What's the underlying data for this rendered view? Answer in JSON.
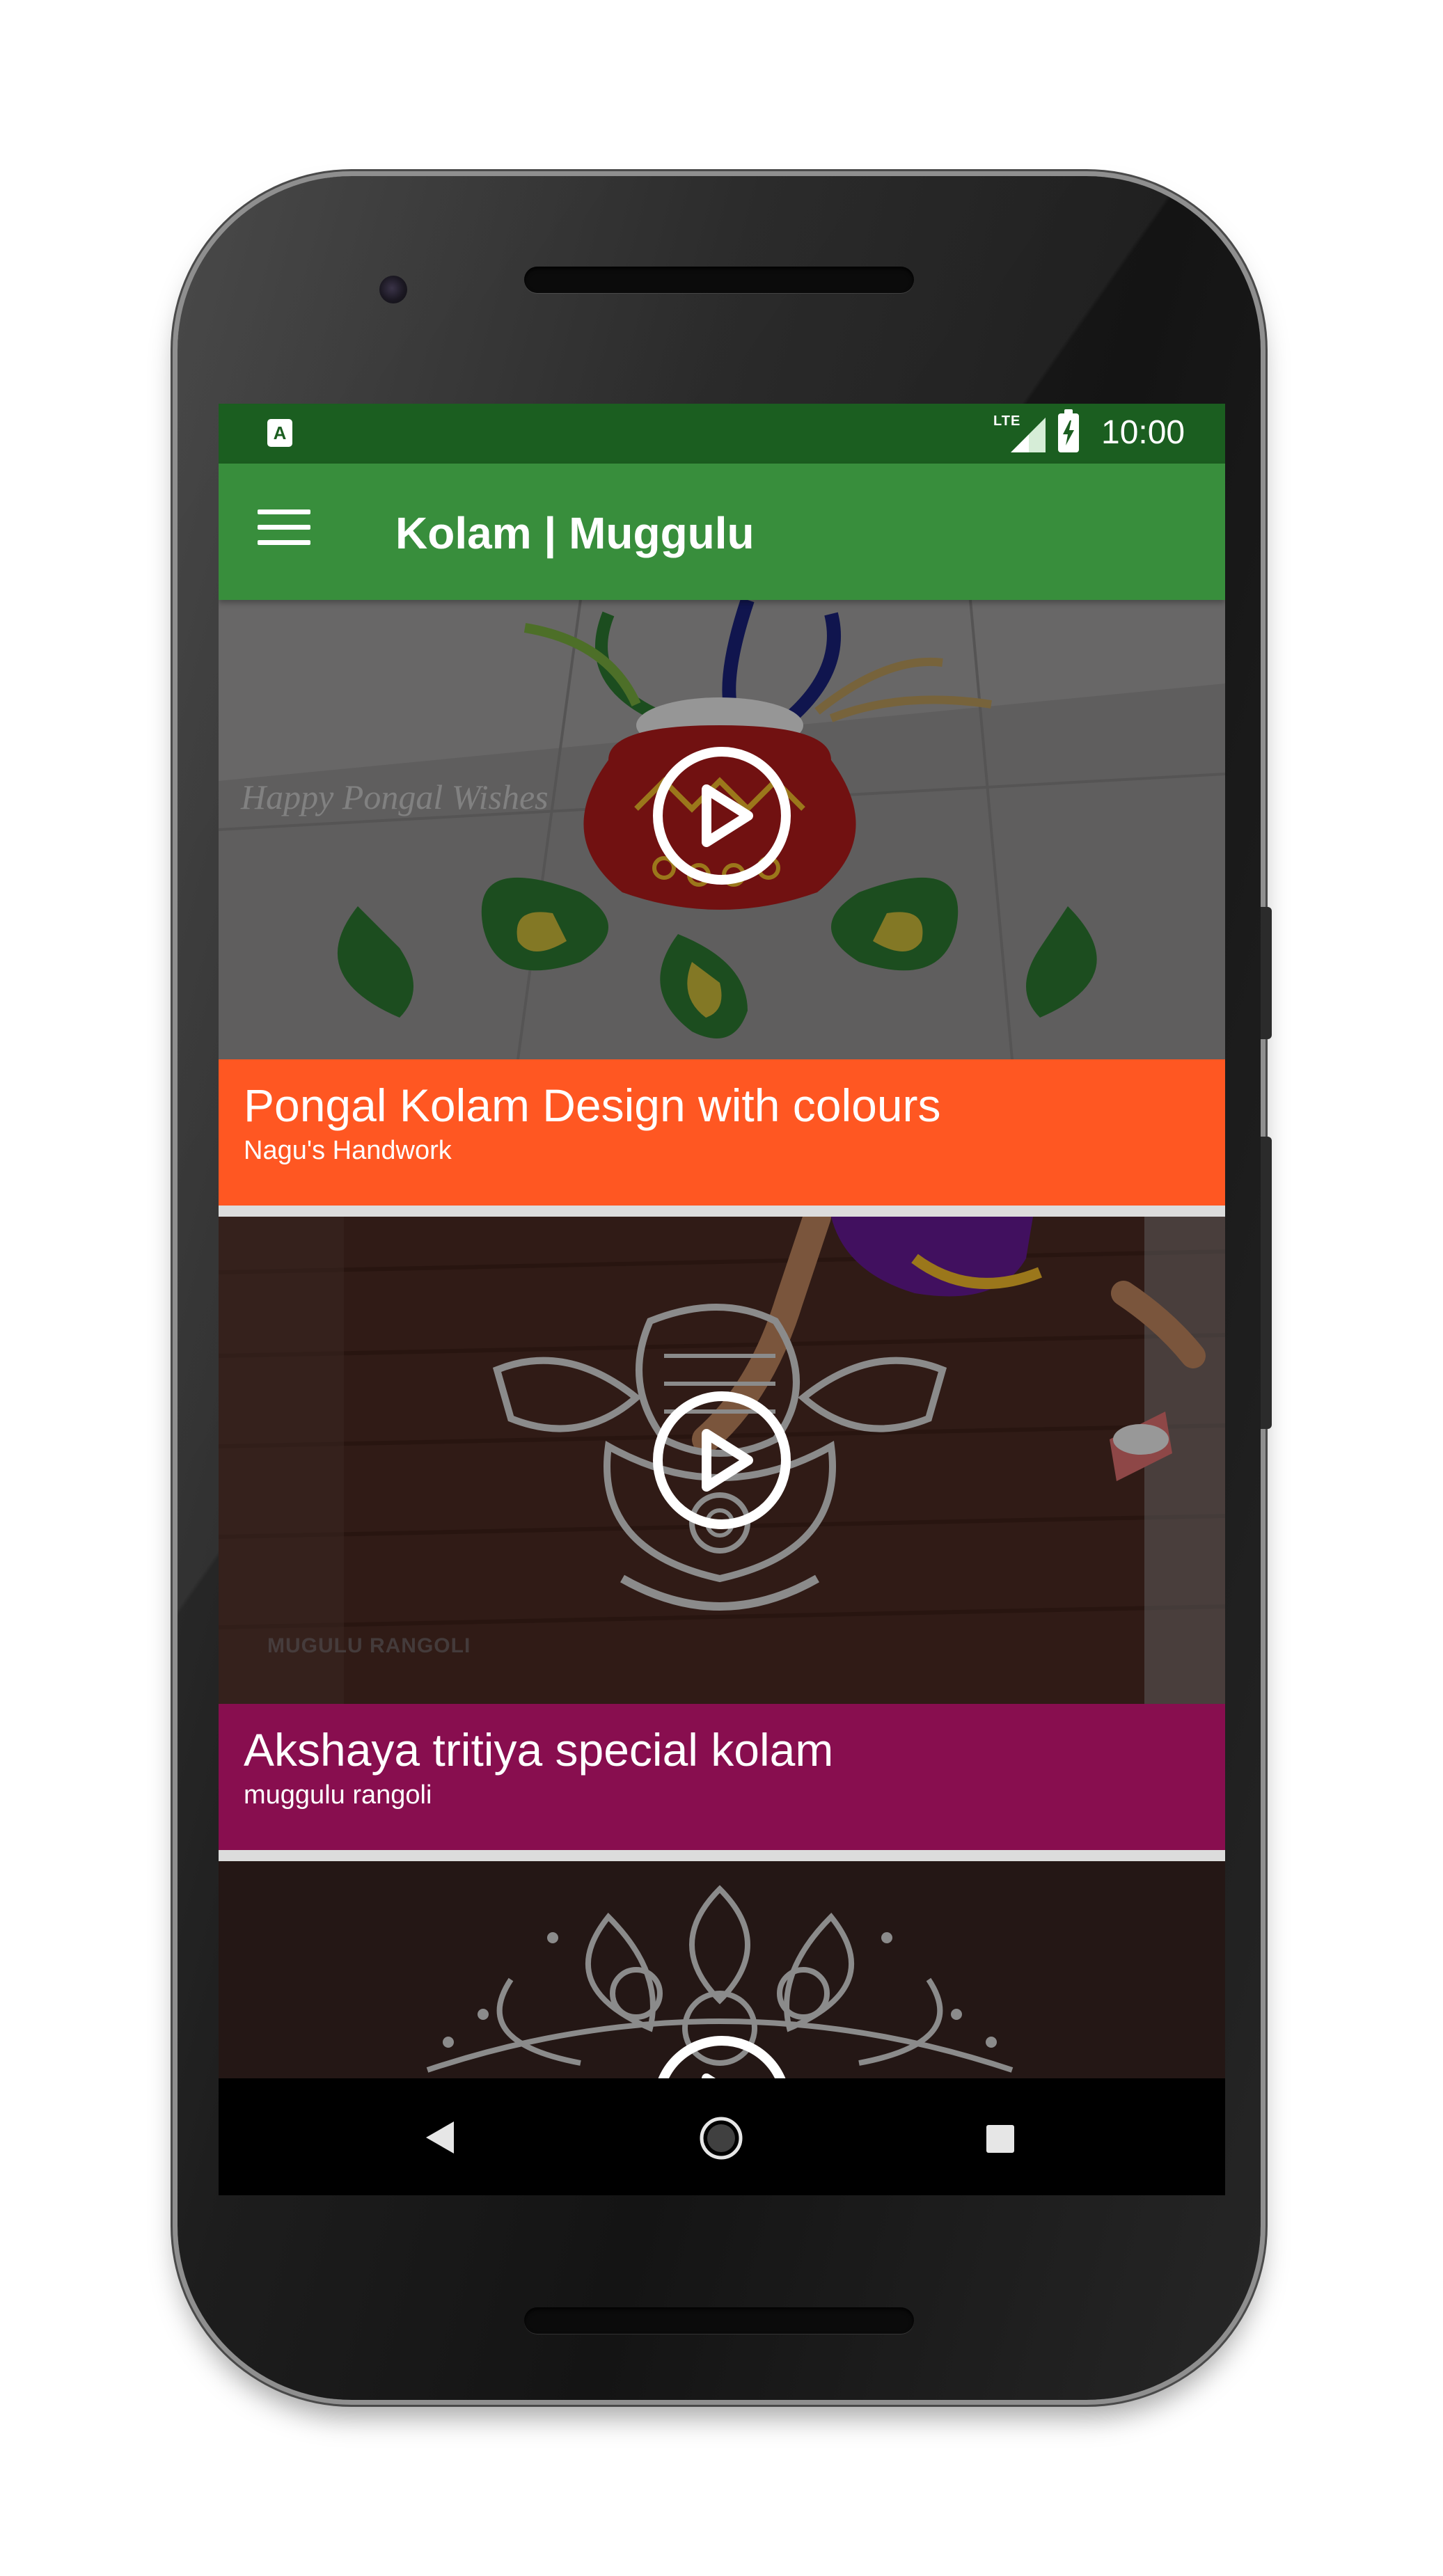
{
  "status_bar": {
    "app_icon_letter": "A",
    "network_label": "LTE",
    "time": "10:00"
  },
  "app_bar": {
    "title": "Kolam | Muggulu"
  },
  "videos": [
    {
      "title": "Pongal Kolam Design with colours",
      "channel": "Nagu's Handwork",
      "thumbnail_text": "Happy Pongal Wishes",
      "caption_color": "#ff5722"
    },
    {
      "title": "Akshaya tritiya special kolam",
      "channel": "muggulu rangoli",
      "thumbnail_text": "MUGULU RANGOLI",
      "caption_color": "#880e4f"
    },
    {
      "title": "",
      "channel": "",
      "thumbnail_text": "",
      "caption_color": "#4e342e"
    }
  ],
  "nav_bar": {
    "back_icon": "triangle-back-icon",
    "home_icon": "circle-home-icon",
    "recents_icon": "square-recents-icon"
  },
  "colors": {
    "status_bar": "#1b5e20",
    "app_bar": "#388e3c",
    "nav_bar": "#000000"
  }
}
